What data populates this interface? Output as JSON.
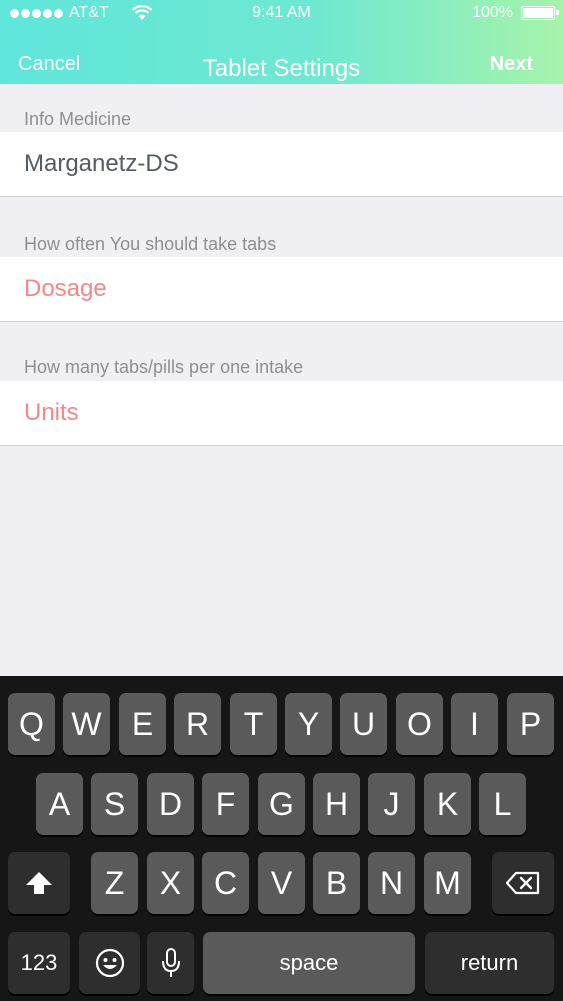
{
  "status_bar": {
    "carrier": "AT&T",
    "time": "9:41 AM",
    "battery": "100%"
  },
  "nav": {
    "cancel": "Cancel",
    "title": "Tablet Settings",
    "next": "Next"
  },
  "sections": [
    {
      "label": "Info Medicine",
      "value": "Marganetz-DS"
    },
    {
      "label": "How often You should take tabs",
      "placeholder": "Dosage"
    },
    {
      "label": "How many tabs/pills per one intake",
      "placeholder": "Units"
    }
  ],
  "keyboard": {
    "row1": [
      "Q",
      "W",
      "E",
      "R",
      "T",
      "Y",
      "U",
      "O",
      "I",
      "P"
    ],
    "row2": [
      "A",
      "S",
      "D",
      "F",
      "G",
      "H",
      "J",
      "K",
      "L"
    ],
    "row3": [
      "Z",
      "X",
      "C",
      "V",
      "B",
      "N",
      "M"
    ],
    "numbers": "123",
    "space": "space",
    "return": "return",
    "icons": {
      "shift": "shift-arrow-icon",
      "delete": "backspace-icon",
      "emoji": "emoji-face-icon",
      "mic": "microphone-icon"
    }
  }
}
